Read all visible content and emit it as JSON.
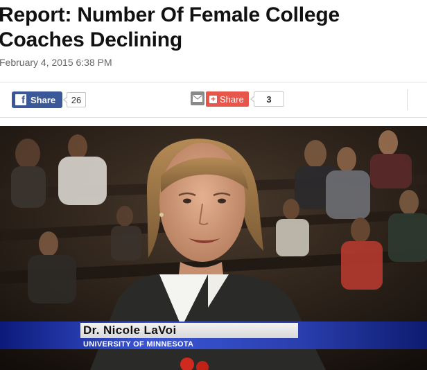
{
  "article": {
    "headline": "Report: Number Of Female College Coaches Declining",
    "dateline": "February 4, 2015 6:38 PM"
  },
  "share_bar": {
    "facebook": {
      "label": "Share",
      "count": "26",
      "icon": "facebook-f-icon"
    },
    "email": {
      "icon": "envelope-icon"
    },
    "plus_share": {
      "label": "Share",
      "count": "3",
      "icon": "plus-icon"
    }
  },
  "video": {
    "lower_third": {
      "name": "Dr. Nicole LaVoi",
      "affiliation": "UNIVERSITY OF MINNESOTA"
    }
  },
  "colors": {
    "facebook": "#3b5998",
    "plus_share": "#e7564b",
    "lower_third_blue": "#3b56d6"
  }
}
